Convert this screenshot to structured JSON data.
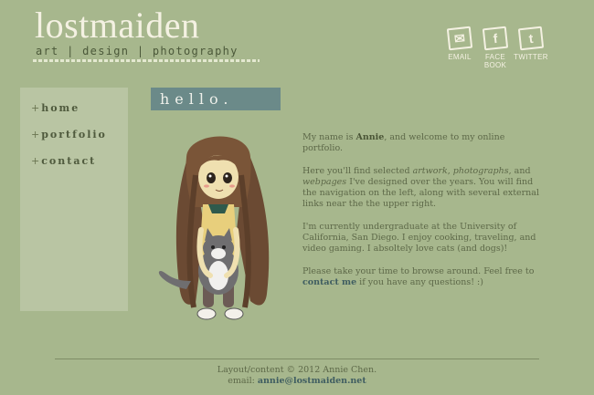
{
  "header": {
    "logo_title": "lostmaiden",
    "logo_subtitle": "art | design | photography"
  },
  "social": [
    {
      "label": "EMAIL",
      "icon": "email-icon",
      "glyph": "✉"
    },
    {
      "label": "FACE\nBOOK",
      "icon": "facebook-icon",
      "glyph": "f"
    },
    {
      "label": "TWITTER",
      "icon": "twitter-icon",
      "glyph": "t"
    }
  ],
  "nav": [
    {
      "prefix": "+",
      "label": "home"
    },
    {
      "prefix": "+",
      "label": "portfolio"
    },
    {
      "prefix": "+",
      "label": "contact"
    }
  ],
  "main": {
    "heading": "hello.",
    "p1_pre": "My name is ",
    "p1_name": "Annie",
    "p1_post": ", and welcome to my online portfolio.",
    "p2_pre": "Here you'll find selected ",
    "p2_em1": "artwork",
    "p2_sep1": ", ",
    "p2_em2": "photographs",
    "p2_sep2": ", and ",
    "p2_em3": "webpages",
    "p2_post": " I've designed over the years. You will find the navigation on the left, along with several external links near the the upper right.",
    "p3": "I'm currently undergraduate at the University of California, San Diego. I enjoy cooking, traveling, and video gaming. I absoltely love cats (and dogs)!",
    "p4_pre": "Please take your time to browse around. Feel free to ",
    "p4_link": "contact me",
    "p4_post": " if you have any questions! :)"
  },
  "footer": {
    "copyright": "Layout/content © 2012 Annie Chen.",
    "email_label": "email: ",
    "email": "annie@lostmaiden.net"
  },
  "colors": {
    "background": "#a7b78d",
    "sidebar": "#b9c5a3",
    "heading_bg": "#6b8a89",
    "link": "#3f5d61"
  }
}
